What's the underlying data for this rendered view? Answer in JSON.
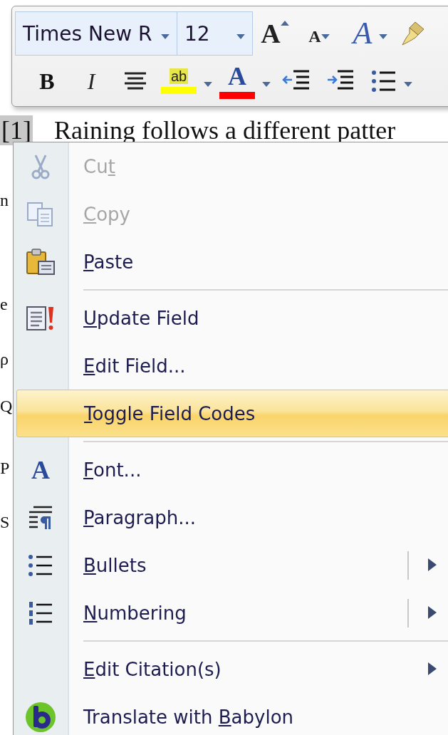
{
  "toolbar": {
    "font": {
      "value": "Times New R"
    },
    "size": {
      "value": "12"
    },
    "row1": [
      {
        "kind": "grow",
        "glyph": "A"
      },
      {
        "kind": "shrink",
        "glyph": "A"
      },
      {
        "kind": "styles",
        "glyph": "A"
      },
      {
        "kind": "painter"
      }
    ],
    "row2": [
      {
        "kind": "bold",
        "glyph": "B"
      },
      {
        "kind": "italic",
        "glyph": "I"
      },
      {
        "kind": "center"
      },
      {
        "kind": "highlight",
        "glyph": "ab"
      },
      {
        "kind": "color",
        "glyph": "A"
      },
      {
        "kind": "outdent"
      },
      {
        "kind": "indent"
      },
      {
        "kind": "bullets"
      }
    ]
  },
  "document": {
    "field": "[1]",
    "first_line": "Raining follows a different patter",
    "fragments": [
      "n",
      "e",
      "ρ",
      "Q",
      "P",
      "S"
    ]
  },
  "menu": [
    {
      "kind": "item",
      "before": "Cu",
      "key": "t",
      "disabled": true,
      "selected": false
    },
    {
      "kind": "item",
      "key": "C",
      "after": "opy",
      "disabled": true,
      "selected": false
    },
    {
      "kind": "item",
      "key": "P",
      "after": "aste",
      "disabled": false,
      "selected": false
    },
    {
      "kind": "separator"
    },
    {
      "kind": "item",
      "key": "U",
      "after": "pdate Field",
      "disabled": false,
      "selected": false
    },
    {
      "kind": "item",
      "key": "E",
      "after": "dit Field...",
      "disabled": false,
      "selected": false
    },
    {
      "kind": "item",
      "key": "T",
      "after": "oggle Field Codes",
      "disabled": false,
      "selected": true
    },
    {
      "kind": "separator"
    },
    {
      "kind": "item",
      "key": "F",
      "after": "ont...",
      "disabled": false,
      "selected": false,
      "icon_glyph": "A"
    },
    {
      "kind": "item",
      "key": "P",
      "after": "aragraph...",
      "disabled": false,
      "selected": false
    },
    {
      "kind": "item",
      "key": "B",
      "after": "ullets",
      "disabled": false,
      "selected": false,
      "submenu": true,
      "split": true
    },
    {
      "kind": "item",
      "key": "N",
      "after": "umbering",
      "disabled": false,
      "selected": false,
      "submenu": true,
      "split": true
    },
    {
      "kind": "separator"
    },
    {
      "kind": "item",
      "key": "E",
      "after": "dit Citation(s)",
      "disabled": false,
      "selected": false,
      "submenu": true,
      "split": false
    },
    {
      "kind": "item",
      "before": "Translate with ",
      "key": "B",
      "after": "abylon",
      "disabled": false,
      "selected": false
    }
  ]
}
